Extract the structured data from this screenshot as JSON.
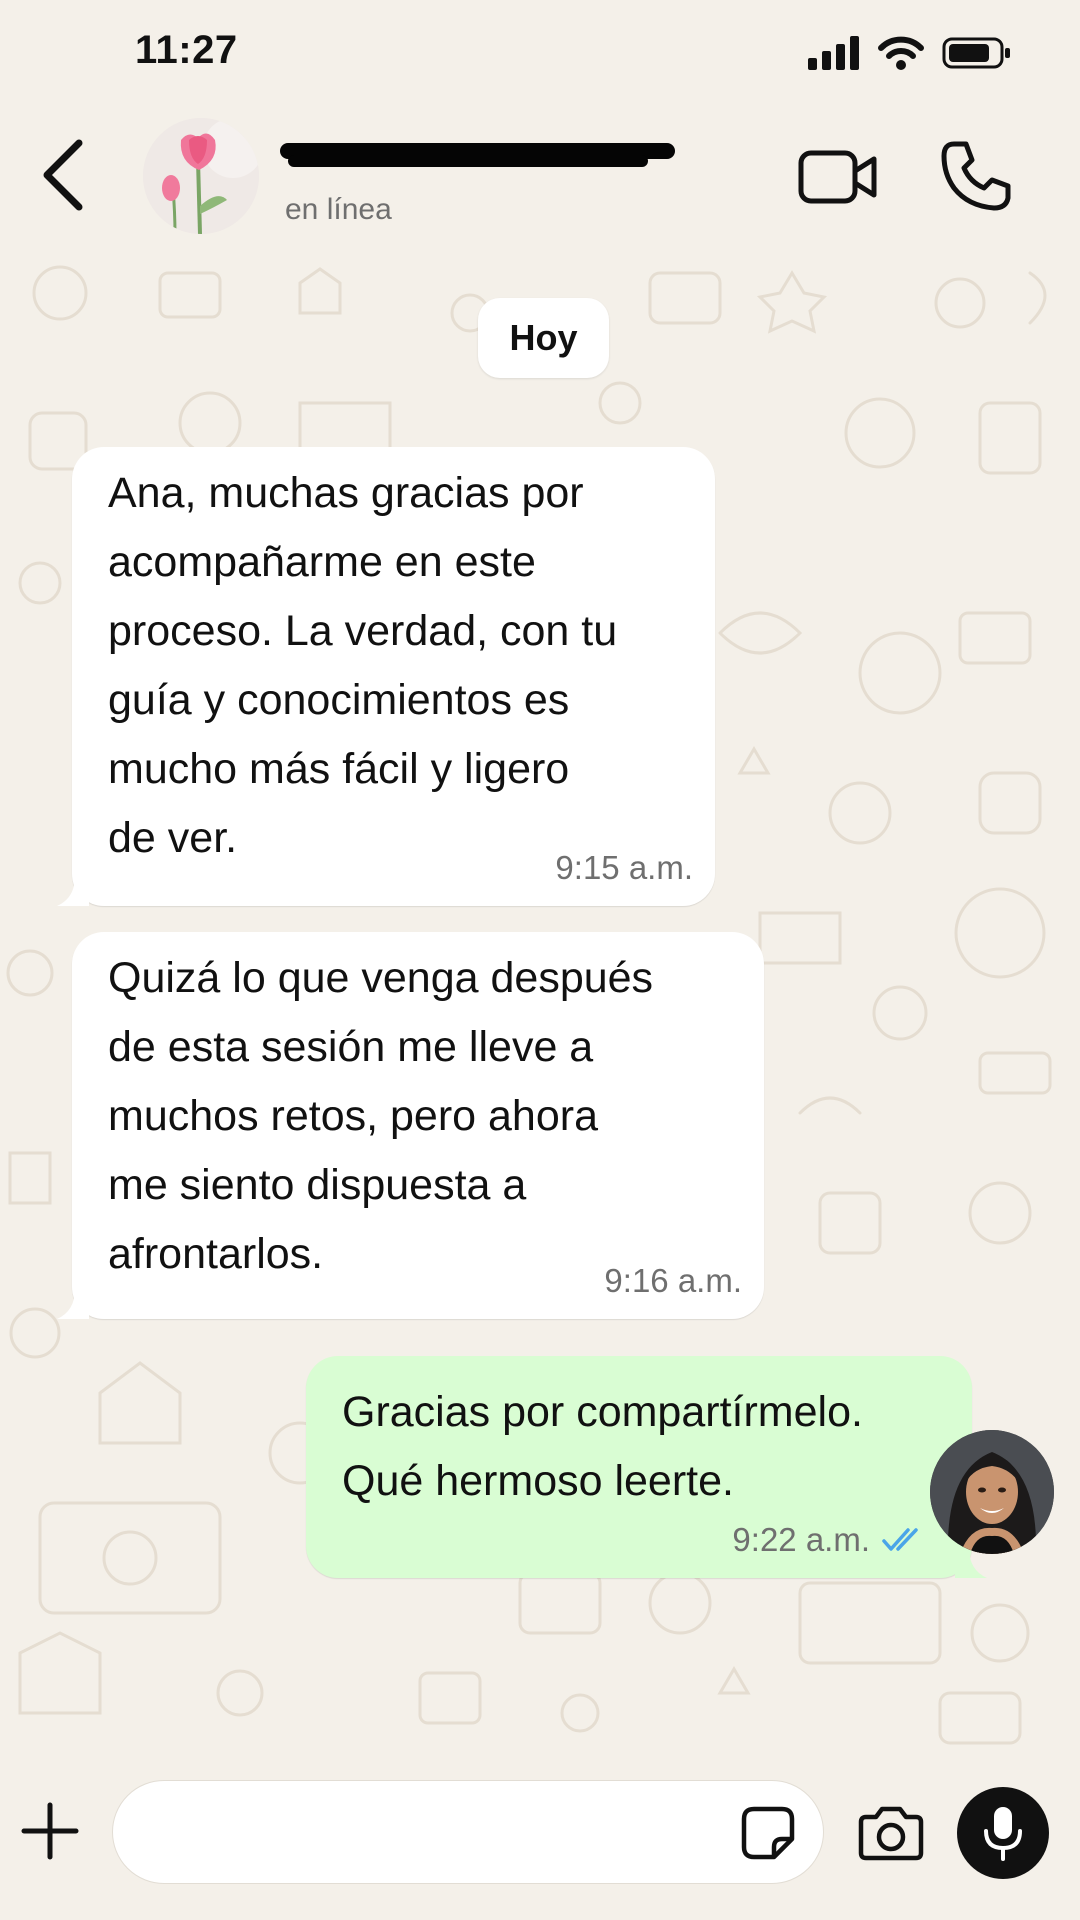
{
  "status_bar": {
    "time": "11:27",
    "icons": [
      "signal-icon",
      "wifi-icon",
      "battery-icon"
    ]
  },
  "header": {
    "contact_name": "",
    "contact_status": "en línea",
    "icons": [
      "back-chevron-icon",
      "tulip-avatar",
      "video-camera-icon",
      "phone-icon"
    ]
  },
  "chat": {
    "date_separator": "Hoy",
    "messages": [
      {
        "direction": "incoming",
        "lines": [
          "Ana, muchas gracias por",
          "acompañarme en este",
          "proceso. La verdad, con tu",
          "guía y conocimientos es",
          "mucho más fácil y ligero",
          "de ver."
        ],
        "time": "9:15 a.m."
      },
      {
        "direction": "incoming",
        "lines": [
          "Quizá lo que venga después",
          "de esta sesión me lleve a",
          "muchos retos, pero ahora",
          "me siento dispuesta a",
          "afrontarlos."
        ],
        "time": "9:16 a.m."
      },
      {
        "direction": "outgoing",
        "lines": [
          "Gracias por compartírmelo.",
          "Qué hermoso leerte."
        ],
        "time": "9:22 a.m.",
        "status_icon": "double-check-icon"
      }
    ]
  },
  "input_bar": {
    "placeholder": "",
    "icons": [
      "plus-icon",
      "sticker-icon",
      "camera-icon",
      "microphone-icon"
    ]
  },
  "colors": {
    "background": "#f4f0e9",
    "incoming_bubble": "#ffffff",
    "outgoing_bubble": "#d9fdd3",
    "read_check": "#4aa5e8",
    "meta_text": "#6f6f6f"
  }
}
